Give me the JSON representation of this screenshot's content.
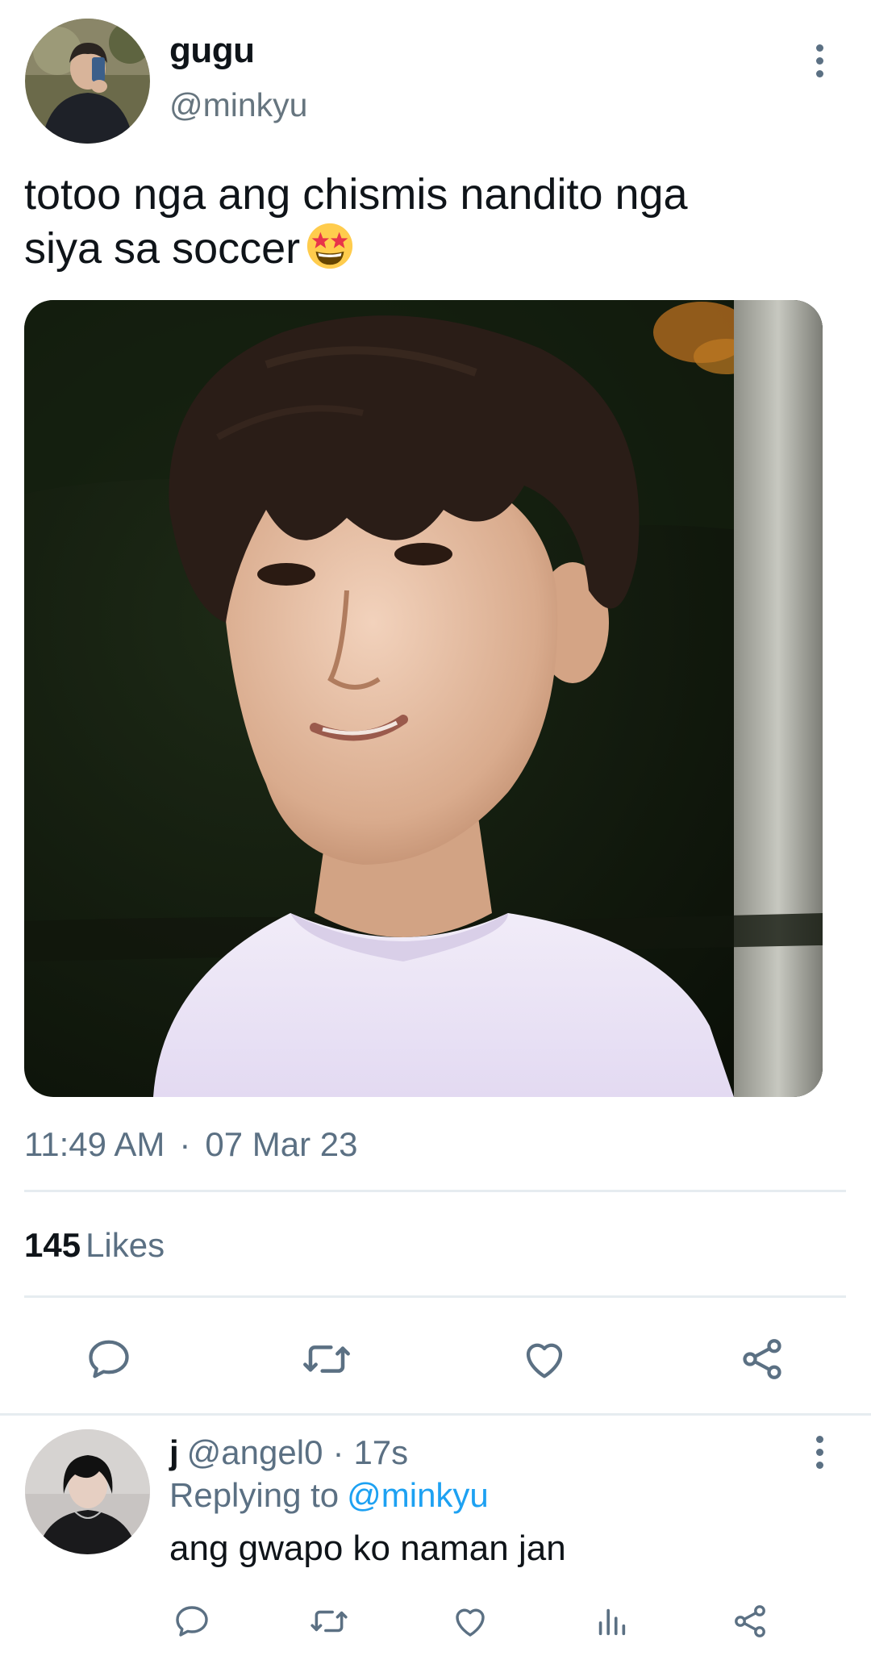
{
  "tweet": {
    "display_name": "gugu",
    "handle": "@minkyu",
    "text_line1": "totoo nga ang chismis nandito nga",
    "text_line2": "siya sa soccer",
    "emoji": "star-struck",
    "time": "11:49 AM",
    "date": "07 Mar 23",
    "likes_count": "145",
    "likes_label": "Likes"
  },
  "reply": {
    "display_name": "j",
    "handle": "@angel0",
    "age": "17s",
    "replying_label": "Replying to",
    "replying_to": "@minkyu",
    "text": "ang gwapo ko naman jan"
  },
  "icons": {
    "main_actions": [
      "reply-icon",
      "retweet-icon",
      "like-icon",
      "share-icon"
    ],
    "reply_actions": [
      "reply-icon",
      "retweet-icon",
      "like-icon",
      "analytics-icon",
      "share-icon"
    ]
  },
  "colors": {
    "text_primary": "#0f1419",
    "text_secondary": "#5b7083",
    "link": "#1da1f2",
    "divider": "#e6ecf0"
  }
}
